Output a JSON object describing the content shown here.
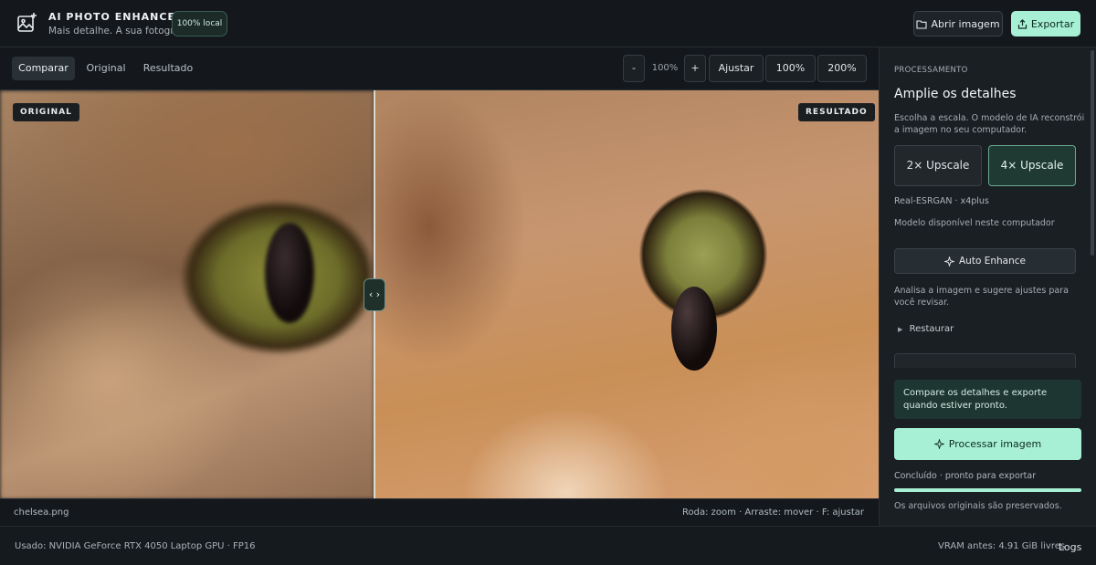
{
  "header": {
    "title": "AI PHOTO ENHANCER",
    "subtitle": "Mais detalhe. A sua fotografia.",
    "badge": "100% local",
    "open_label": "Abrir imagem",
    "export_label": "Exportar",
    "logo_icon": "image-plus-icon",
    "open_icon": "folder-icon",
    "export_icon": "export-icon"
  },
  "toolbar": {
    "tabs": [
      "Comparar",
      "Original",
      "Resultado"
    ],
    "active_tab": "Comparar",
    "zoom_out": "-",
    "zoom_value": "100%",
    "zoom_in": "+",
    "fit": "Ajustar",
    "zoom_100": "100%",
    "zoom_200": "200%"
  },
  "viewer": {
    "label_original": "ORIGINAL",
    "label_result": "RESULTADO",
    "handle_glyph": "‹ ›",
    "split_fraction": 0.43
  },
  "status": {
    "file_name": "chelsea.png",
    "hints": "Roda: zoom · Arraste: mover · F: ajustar"
  },
  "footer": {
    "gpu": "Usado: NVIDIA GeForce RTX 4050 Laptop GPU · FP16",
    "vram": "VRAM antes: 4.91 GiB livres",
    "logs": "Logs"
  },
  "panel": {
    "section": "PROCESSAMENTO",
    "title": "Amplie os detalhes",
    "description": "Escolha a escala. O modelo de IA reconstrói a imagem no seu computador.",
    "scale_2x": "2× Upscale",
    "scale_4x": "4× Upscale",
    "selected_scale": "4× Upscale",
    "model": "Real-ESRGAN · x4plus",
    "model_status": "Modelo disponível neste computador",
    "auto_enhance": "Auto Enhance",
    "auto_desc": "Analisa a imagem e sugere ajustes para você revisar.",
    "restore": "Restaurar",
    "notice": "Compare os detalhes e exporte quando estiver pronto.",
    "process_label": "Processar imagem",
    "done_status": "Concluído · pronto para exportar",
    "progress": 1.0,
    "preserve_note": "Os arquivos originais são preservados."
  },
  "colors": {
    "accent": "#a7f0d6",
    "background": "#12161a",
    "panel": "#1a1f23"
  }
}
